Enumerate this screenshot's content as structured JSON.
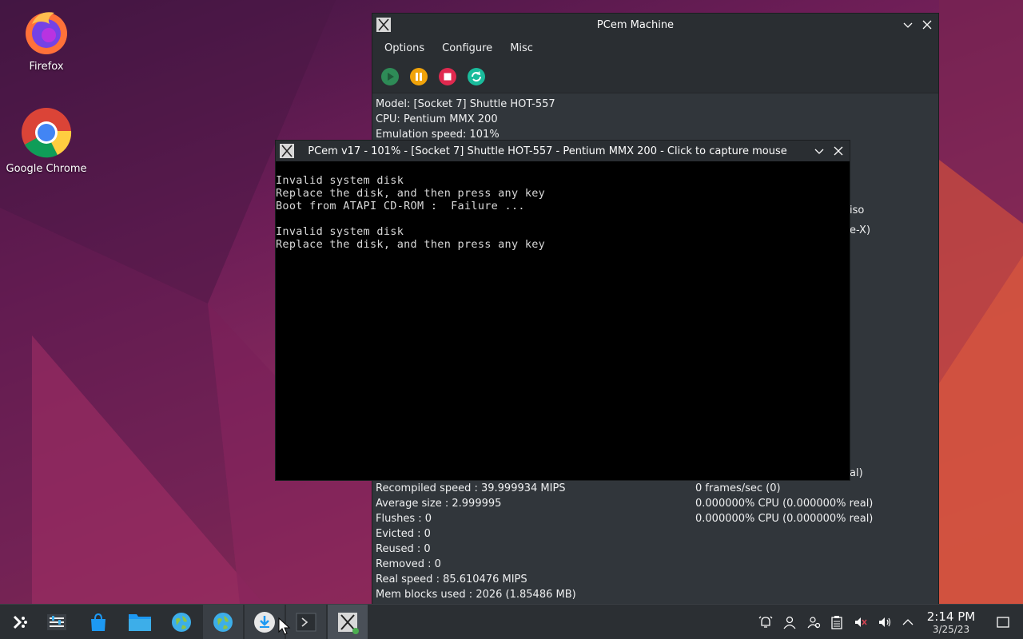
{
  "desktop": {
    "icons": [
      {
        "label": "Firefox",
        "icon": "firefox-icon"
      },
      {
        "label": "Google Chrome",
        "icon": "chrome-icon"
      }
    ]
  },
  "machine_window": {
    "title": "PCem Machine",
    "menu": [
      "Options",
      "Configure",
      "Misc"
    ],
    "toolbar": [
      {
        "icon": "play-icon",
        "color": "#2e8b57"
      },
      {
        "icon": "pause-icon",
        "color": "#f0a30a"
      },
      {
        "icon": "stop-icon",
        "color": "#e0294f"
      },
      {
        "icon": "reset-icon",
        "color": "#1abc9c"
      }
    ],
    "info_top": [
      "Model: [Socket 7] Shuttle HOT-557",
      "CPU: Pentium MMX 200",
      "Emulation speed: 101%"
    ],
    "partial_right": [
      "iso",
      "e-X)",
      "al)"
    ],
    "stats_left": [
      "Recompiled speed : 39.999934 MIPS",
      "Average size : 2.999995",
      "Flushes : 0",
      "Evicted : 0",
      "Reused : 0",
      "Removed : 0",
      "Real speed : 85.610476 MIPS",
      "Mem blocks used : 2026 (1.85486 MB)"
    ],
    "stats_right": [
      "0 frames/sec (0)",
      "0.000000% CPU (0.000000% real)",
      "0.000000% CPU (0.000000% real)"
    ]
  },
  "emu_window": {
    "title": "PCem v17 - 101% - [Socket 7] Shuttle HOT-557 - Pentium MMX 200 - Click to capture mouse",
    "screen_lines": [
      "Invalid system disk",
      "Replace the disk, and then press any key",
      "Boot from ATAPI CD-ROM :  Failure ...",
      "",
      "Invalid system disk",
      "Replace the disk, and then press any key"
    ]
  },
  "taskbar": {
    "items": [
      "app-launcher-icon",
      "system-settings-icon",
      "discover-store-icon",
      "file-manager-icon",
      "browser-globe-icon",
      "browser-globe-icon",
      "download-installer-icon",
      "terminal-icon",
      "pcem-icon"
    ],
    "tray": [
      "notifications-icon",
      "user-icon",
      "users-icon",
      "clipboard-icon",
      "mic-muted-icon",
      "volume-icon",
      "expand-tray-icon"
    ],
    "time": "2:14 PM",
    "date": "3/25/23"
  }
}
